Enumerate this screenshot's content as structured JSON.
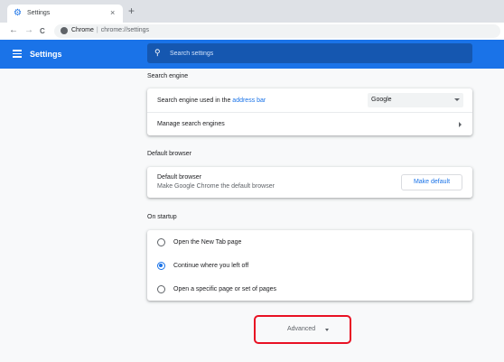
{
  "browser": {
    "tab_title": "Settings",
    "tab_close": "×",
    "new_tab": "+",
    "back": "←",
    "forward": "→",
    "reload": "C",
    "omnibox_site": "Chrome",
    "omnibox_sep": "|",
    "omnibox_url": "chrome://settings"
  },
  "header": {
    "title": "Settings",
    "search_placeholder": "Search settings"
  },
  "search_engine": {
    "section_title": "Search engine",
    "row1_prefix": "Search engine used in the ",
    "row1_link": "address bar",
    "selected_engine": "Google",
    "row2_label": "Manage search engines"
  },
  "default_browser": {
    "section_title": "Default browser",
    "title": "Default browser",
    "subtitle": "Make Google Chrome the default browser",
    "button": "Make default"
  },
  "on_startup": {
    "section_title": "On startup",
    "options": [
      {
        "label": "Open the New Tab page",
        "checked": false
      },
      {
        "label": "Continue where you left off",
        "checked": true
      },
      {
        "label": "Open a specific page or set of pages",
        "checked": false
      }
    ]
  },
  "advanced": {
    "label": "Advanced",
    "highlight_color": "#e81123"
  },
  "colors": {
    "accent": "#1a73e8"
  }
}
